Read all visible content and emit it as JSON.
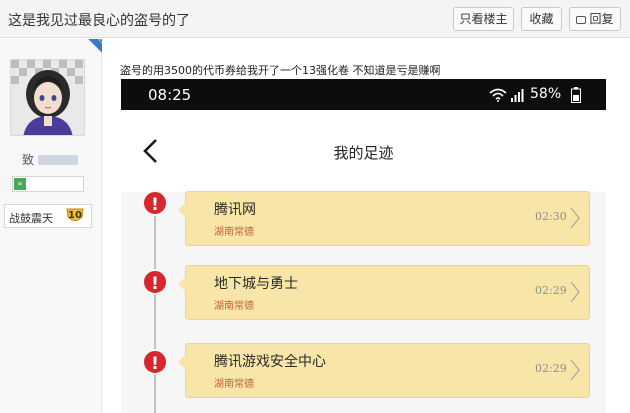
{
  "thread": {
    "title": "这是我见过最良心的盗号的了",
    "buttons": {
      "only_op": "只看楼主",
      "favorite": "收藏",
      "reply": "回复"
    }
  },
  "user": {
    "owner_badge": "楼主",
    "name": "致",
    "rank_label": "战鼓震天",
    "rank_level": "10"
  },
  "post": {
    "caption": "盗号的用3500的代币券给我开了一个13强化卷 不知道是亏是赚啊"
  },
  "phone": {
    "status": {
      "time": "08:25",
      "battery": "58%"
    },
    "page_title": "我的足迹",
    "entries": [
      {
        "name": "腾讯网",
        "location": "湖南常德",
        "time": "02:30"
      },
      {
        "name": "地下城与勇士",
        "location": "湖南常德",
        "time": "02:29"
      },
      {
        "name": "腾讯游戏安全中心",
        "location": "湖南常德",
        "time": "02:29"
      }
    ]
  },
  "colors": {
    "accent_blue": "#3a78c9",
    "card_yellow": "#f7e6a8",
    "alert_red": "#d8262f",
    "location_orange": "#c2603a"
  },
  "icons": [
    "reply-icon",
    "level-icon",
    "rank-badge-icon",
    "wifi-icon",
    "signal-icon",
    "battery-icon",
    "back-arrow-icon",
    "alert-icon",
    "chevron-right-icon"
  ]
}
